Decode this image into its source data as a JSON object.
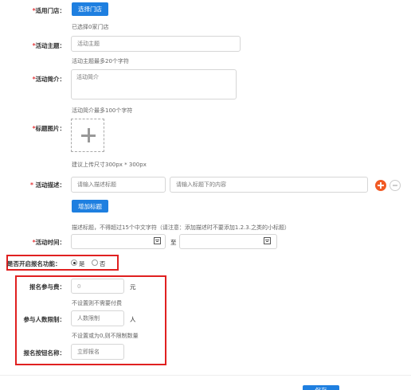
{
  "stores": {
    "label_req": "*",
    "label": "适用门店：",
    "button": "选择门店",
    "hint": "已选择0家门店"
  },
  "theme": {
    "label_req": "*",
    "label": "活动主题：",
    "placeholder": "活动主题",
    "hint": "活动主题最多20个字符"
  },
  "intro": {
    "label_req": "*",
    "label": "活动简介：",
    "placeholder": "活动简介",
    "hint": "活动简介最多100个字符"
  },
  "title_image": {
    "label_req": "*",
    "label": "标题图片：",
    "hint": "建议上传尺寸300px * 300px"
  },
  "description": {
    "label_req": "*",
    "label": " 活动描述：",
    "title_placeholder": "请输入描述标题",
    "content_placeholder": "请输入标题下的内容",
    "add_button": "增加标题",
    "hint": "描述标题，不得超过15个中文字符（请注意：添加描述时不要添加1.2.3.之类的小标题）"
  },
  "time": {
    "label_req": "*",
    "label": "活动时间：",
    "separator": "至"
  },
  "signup": {
    "label": "是否开启报名功能：",
    "yes": "是",
    "no": "否"
  },
  "fee": {
    "label": "报名参与费：",
    "value": "0",
    "unit": "元",
    "hint": "不设置则不需要付费"
  },
  "limit": {
    "label": "参与人数限制：",
    "placeholder": "人数限制",
    "unit": "人",
    "hint": "不设置或为0,则不限制数量"
  },
  "button_name": {
    "label": "报名按钮名称：",
    "placeholder": "立即报名"
  },
  "submit": {
    "label": "保存"
  },
  "colors": {
    "accent": "#1e7fe0",
    "required": "#e4393c",
    "highlight_box": "#e02020",
    "add_icon": "#f15a24"
  }
}
